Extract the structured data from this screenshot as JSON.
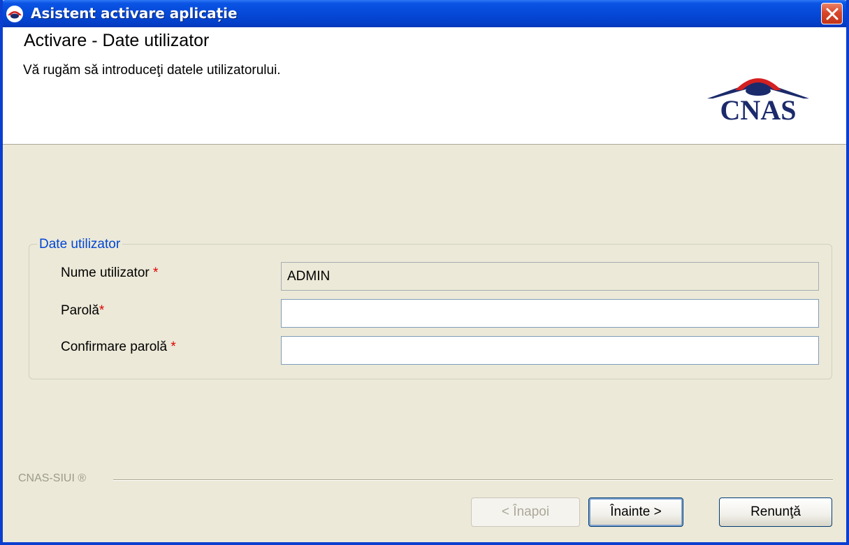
{
  "window": {
    "title": "Asistent activare aplicație",
    "icons": {
      "app": "cnas-app-icon",
      "close": "close-icon"
    }
  },
  "header": {
    "title": "Activare - Date utilizator",
    "subtitle": "Vă rugăm să introduceţi datele utilizatorului.",
    "logo_text": "CNAS"
  },
  "group": {
    "legend": "Date utilizator",
    "fields": [
      {
        "label": "Nume utilizator",
        "required_mark": "*",
        "value": "ADMIN",
        "readonly": true
      },
      {
        "label": "Parolă",
        "required_mark": "*",
        "value": "",
        "readonly": false
      },
      {
        "label": "Confirmare parolă",
        "required_mark": "*",
        "value": "",
        "readonly": false
      }
    ]
  },
  "footer": {
    "brand": "CNAS-SIUI ®",
    "back_label": "< Înapoi",
    "next_label": "Înainte >",
    "cancel_label": "Renunţă"
  },
  "colors": {
    "titlebar": "#0547d6",
    "dialog_bg": "#ece9d8",
    "legend": "#0046d5",
    "required": "#e00000",
    "logo": "#1b2a6b"
  }
}
